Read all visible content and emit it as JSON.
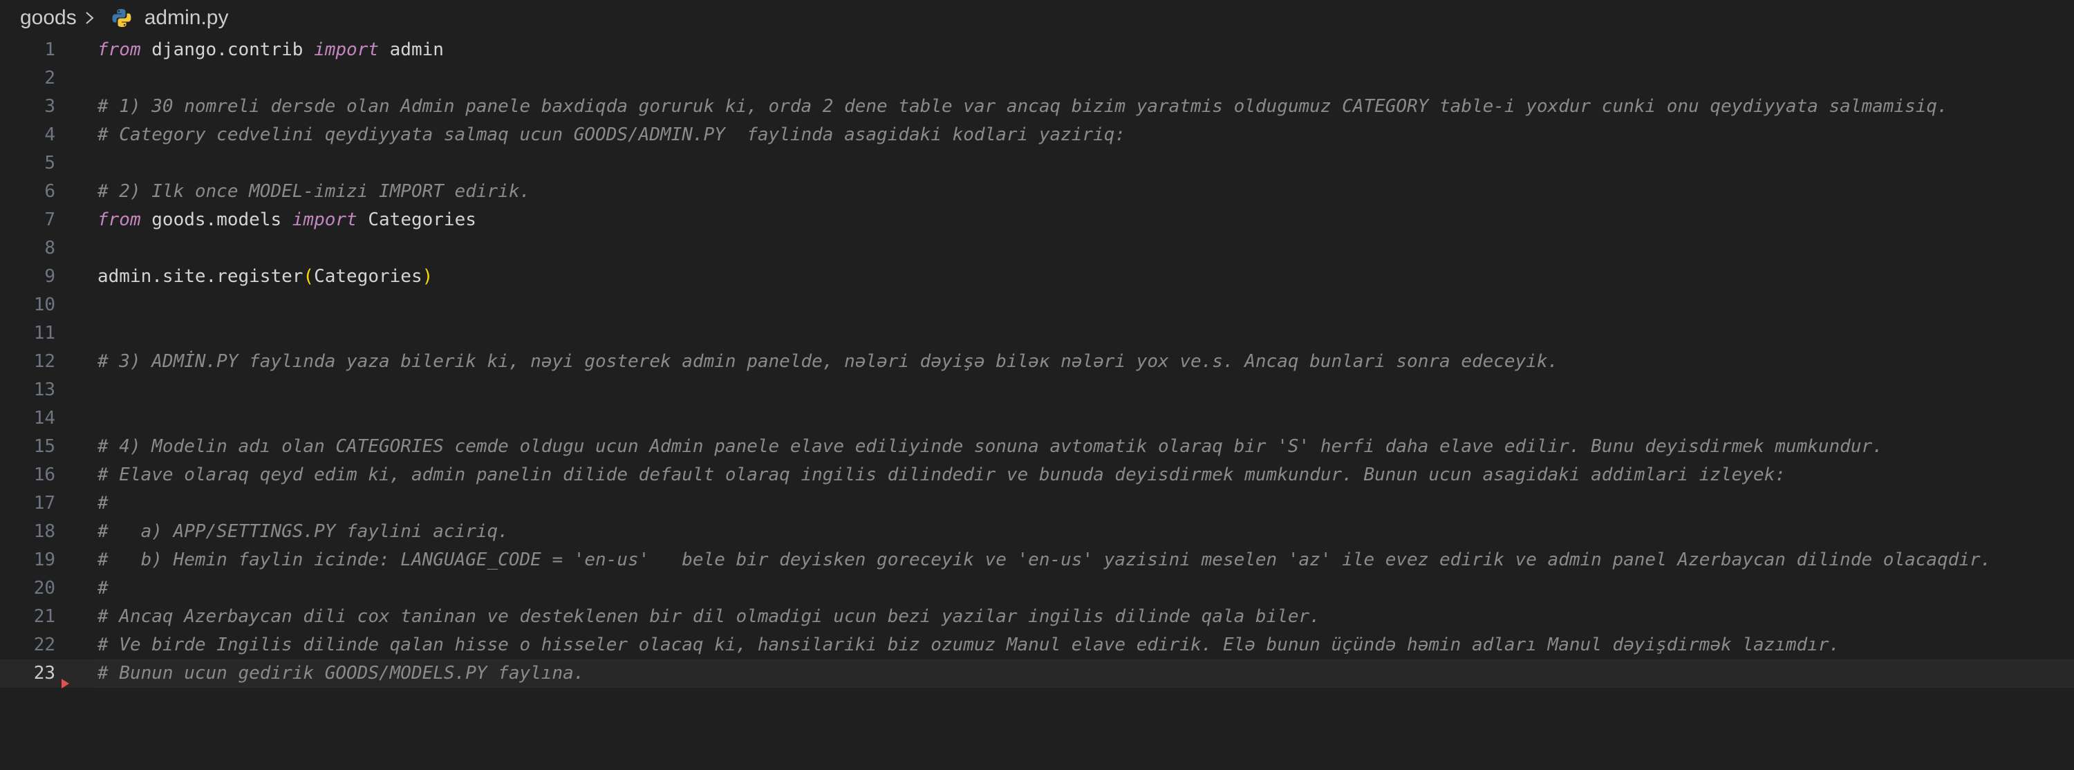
{
  "breadcrumb": {
    "folder": "goods",
    "file": "admin.py"
  },
  "colors": {
    "background": "#1f1f1f",
    "keyword": "#c586c0",
    "comment": "#8a8a8a",
    "text": "#d4d4d4",
    "bracket": "#ffd700",
    "line_number": "#6e7681",
    "current_line_marker": "#e05252"
  },
  "icons": {
    "separator": "chevron-right-icon",
    "file": "python-file-icon"
  },
  "editor": {
    "current_line": 23,
    "lines": [
      {
        "n": "1",
        "tokens": [
          {
            "t": "kw",
            "v": "from"
          },
          {
            "t": "tx",
            "v": " django.contrib "
          },
          {
            "t": "kw",
            "v": "import"
          },
          {
            "t": "tx",
            "v": " admin"
          }
        ]
      },
      {
        "n": "2",
        "tokens": []
      },
      {
        "n": "3",
        "tokens": [
          {
            "t": "cm",
            "v": "# 1) 30 nomreli dersde olan Admin panele baxdiqda goruruk ki, orda 2 dene table var ancaq bizim yaratmis oldugumuz CATEGORY table-i yoxdur cunki onu qeydiyyata salmamisiq."
          }
        ]
      },
      {
        "n": "4",
        "tokens": [
          {
            "t": "cm",
            "v": "# Category cedvelini qeydiyyata salmaq ucun GOODS/ADMIN.PY  faylinda asagidaki kodlari yaziriq:"
          }
        ]
      },
      {
        "n": "5",
        "tokens": []
      },
      {
        "n": "6",
        "tokens": [
          {
            "t": "cm",
            "v": "# 2) Ilk once MODEL-imizi IMPORT edirik."
          }
        ]
      },
      {
        "n": "7",
        "tokens": [
          {
            "t": "kw",
            "v": "from"
          },
          {
            "t": "tx",
            "v": " goods.models "
          },
          {
            "t": "kw",
            "v": "import"
          },
          {
            "t": "tx",
            "v": " Categories"
          }
        ]
      },
      {
        "n": "8",
        "tokens": []
      },
      {
        "n": "9",
        "tokens": [
          {
            "t": "tx",
            "v": "admin.site.register"
          },
          {
            "t": "pr",
            "v": "("
          },
          {
            "t": "tx",
            "v": "Categories"
          },
          {
            "t": "pr",
            "v": ")"
          }
        ]
      },
      {
        "n": "10",
        "tokens": []
      },
      {
        "n": "11",
        "tokens": []
      },
      {
        "n": "12",
        "tokens": [
          {
            "t": "cm",
            "v": "# 3) ADMİN.PY faylında yaza bilerik ki, nəyi gosterek admin panelde, nələri dəyişə biləк nələri yox ve.s. Ancaq bunlari sonra edeceyik."
          }
        ]
      },
      {
        "n": "13",
        "tokens": []
      },
      {
        "n": "14",
        "tokens": []
      },
      {
        "n": "15",
        "tokens": [
          {
            "t": "cm",
            "v": "# 4) Modelin adı olan CATEGORIES cemde oldugu ucun Admin panele elave ediliyinde sonuna avtomatik olaraq bir 'S' herfi daha elave edilir. Bunu deyisdirmek mumkundur."
          }
        ]
      },
      {
        "n": "16",
        "tokens": [
          {
            "t": "cm",
            "v": "# Elave olaraq qeyd edim ki, admin panelin dilide default olaraq ingilis dilindedir ve bunuda deyisdirmek mumkundur. Bunun ucun asagidaki addimlari izleyek:"
          }
        ]
      },
      {
        "n": "17",
        "tokens": [
          {
            "t": "cm",
            "v": "#"
          }
        ]
      },
      {
        "n": "18",
        "tokens": [
          {
            "t": "cm",
            "v": "#   a) APP/SETTINGS.PY faylini aciriq."
          }
        ]
      },
      {
        "n": "19",
        "tokens": [
          {
            "t": "cm",
            "v": "#   b) Hemin faylin icinde: LANGUAGE_CODE = 'en-us'   bele bir deyisken goreceyik ve 'en-us' yazisini meselen 'az' ile evez edirik ve admin panel Azerbaycan dilinde olacaqdir."
          }
        ]
      },
      {
        "n": "20",
        "tokens": [
          {
            "t": "cm",
            "v": "#"
          }
        ]
      },
      {
        "n": "21",
        "tokens": [
          {
            "t": "cm",
            "v": "# Ancaq Azerbaycan dili cox taninan ve desteklenen bir dil olmadigi ucun bezi yazilar ingilis dilinde qala biler."
          }
        ]
      },
      {
        "n": "22",
        "tokens": [
          {
            "t": "cm",
            "v": "# Ve birde Ingilis dilinde qalan hisse o hisseler olacaq ki, hansilariki biz ozumuz Manul elave edirik. Elə bunun üçündə həmin adları Manul dəyişdirmək lazımdır."
          }
        ]
      },
      {
        "n": "23",
        "tokens": [
          {
            "t": "cm",
            "v": "# Bunun ucun gedirik GOODS/MODELS.PY faylına."
          }
        ]
      }
    ]
  }
}
